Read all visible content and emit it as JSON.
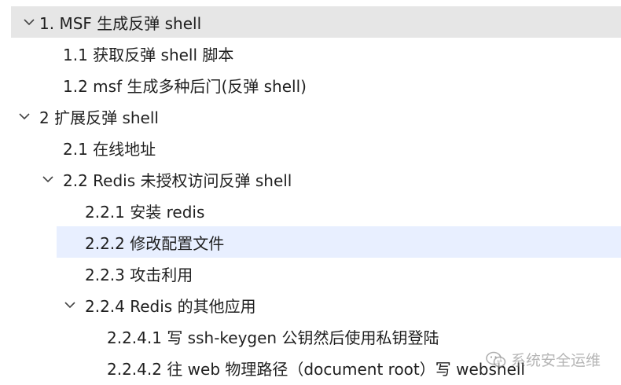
{
  "outline": {
    "items": [
      {
        "label": "1. MSF 生成反弹 shell",
        "expanded": true
      },
      {
        "label": "1.1 获取反弹 shell 脚本"
      },
      {
        "label": "1.2 msf 生成多种后门(反弹 shell)"
      },
      {
        "label": "2  扩展反弹 shell",
        "expanded": true
      },
      {
        "label": "2.1  在线地址"
      },
      {
        "label": "2.2 Redis 未授权访问反弹 shell",
        "expanded": true
      },
      {
        "label": "2.2.1  安装 redis"
      },
      {
        "label": "2.2.2  修改配置文件",
        "selected": true
      },
      {
        "label": "2.2.3  攻击利用"
      },
      {
        "label": "2.2.4 Redis 的其他应用",
        "expanded": true
      },
      {
        "label": "2.2.4.1  写 ssh-keygen 公钥然后使用私钥登陆"
      },
      {
        "label": "2.2.4.2  往 web 物理路径（document root）写 webshell"
      }
    ]
  },
  "watermark": {
    "text": "系统安全运维",
    "icon": "wechat-icon"
  },
  "colors": {
    "top_highlight": "#e6e6e6",
    "selected_highlight": "#e8efff",
    "text": "#1f1f1f",
    "chevron": "#444444"
  }
}
